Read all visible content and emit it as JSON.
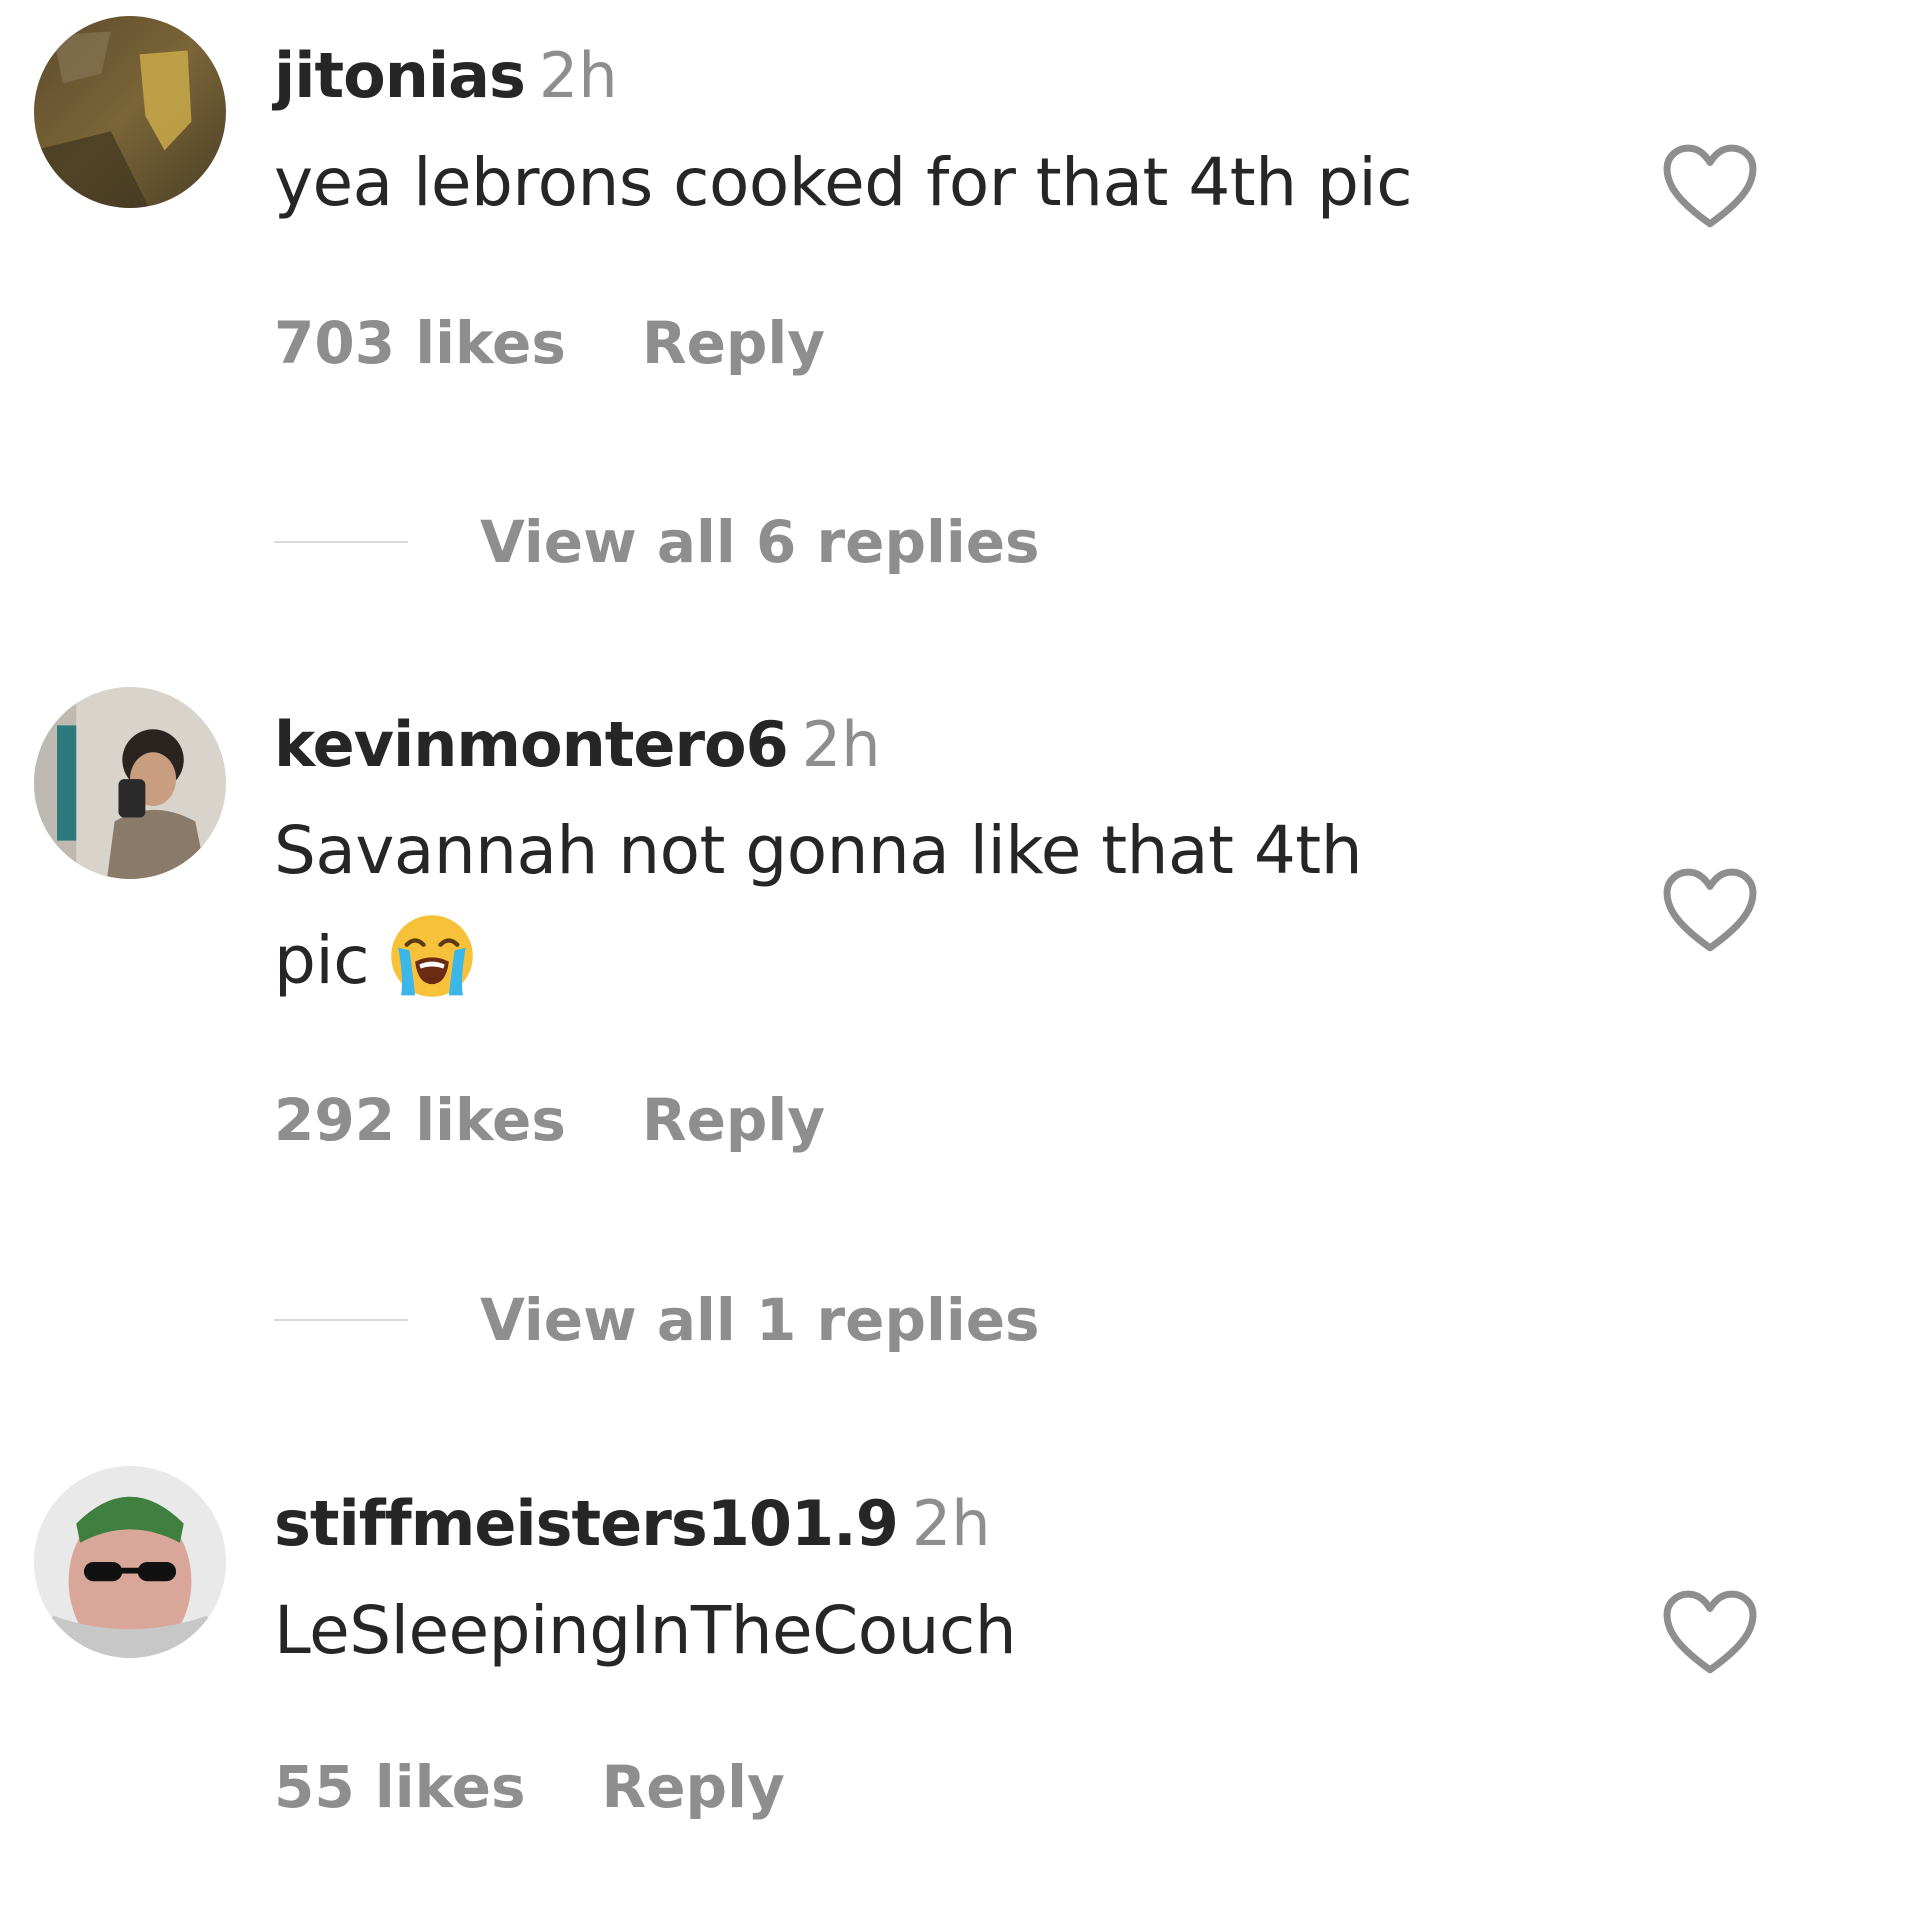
{
  "comments": [
    {
      "username": "jitonias",
      "time": "2h",
      "text_lines": [
        "yea lebrons cooked for that 4th pic"
      ],
      "likes": "703 likes",
      "reply_label": "Reply",
      "view_replies": "View all 6 replies",
      "avatar_icon": "profile-photo"
    },
    {
      "username": "kevinmontero6",
      "time": "2h",
      "text_lines": [
        "Savannah not gonna like that 4th",
        "pic"
      ],
      "emoji": "loudly-crying-face",
      "likes": "292 likes",
      "reply_label": "Reply",
      "view_replies": "View all 1 replies",
      "avatar_icon": "profile-photo"
    },
    {
      "username": "stiffmeisters101.9",
      "time": "2h",
      "text_lines": [
        "LeSleepingInTheCouch"
      ],
      "likes": "55 likes",
      "reply_label": "Reply",
      "avatar_icon": "profile-photo"
    }
  ],
  "icons": {
    "like": "heart-outline-icon"
  },
  "colors": {
    "text": "#262626",
    "secondary": "#8e8e8e",
    "divider": "#dbdbdb"
  }
}
